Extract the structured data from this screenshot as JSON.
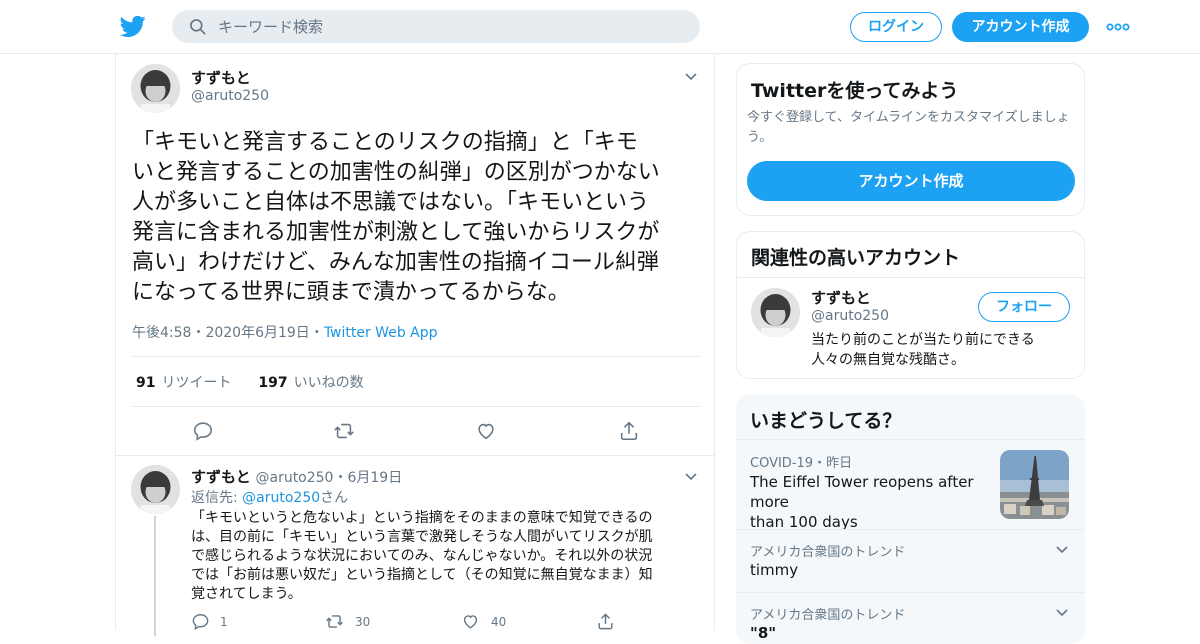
{
  "header": {
    "search_placeholder": "キーワード検索",
    "login_label": "ログイン",
    "signup_label": "アカウント作成"
  },
  "tweet": {
    "name": "すずもと",
    "handle": "@aruto250",
    "text_lines": [
      "「キモいと発言することのリスクの指摘」と「キモ",
      "いと発言することの加害性の糾弾」の区別がつかない",
      "人が多いこと自体は不思議ではない。「キモいという",
      "発言に含まれる加害性が刺激として強いからリスクが",
      "高い」わけだけど、みんな加害性の指摘イコール糾弾",
      "になってる世界に頭まで漬かってるからな。"
    ],
    "time": "午後4:58",
    "date": "2020年6月19日",
    "sep": "・",
    "source": "Twitter Web App",
    "retweets": "91",
    "retweets_label": "リツイート",
    "likes": "197",
    "likes_label": "いいねの数"
  },
  "reply": {
    "name": "すずもと",
    "handle": "@aruto250",
    "sep": "・",
    "date": "6月19日",
    "reply_to_prefix": "返信先: ",
    "reply_to_handle": "@aruto250",
    "reply_to_suffix": "さん",
    "text_lines": [
      "「キモいというと危ないよ」という指摘をそのままの意味で知覚できるの",
      "は、目の前に「キモい」という言葉で激発しそうな人間がいてリスクが肌",
      "で感じられるような状況においてのみ、なんじゃないか。それ以外の状況",
      "では「お前は悪い奴だ」という指摘として（その知覚に無自覚なまま）知",
      "覚されてしまう。"
    ],
    "reply_count": "1",
    "retweet_count": "30",
    "like_count": "40"
  },
  "signup_card": {
    "title": "Twitterを使ってみよう",
    "subtitle_lines": [
      "今すぐ登録して、タイムラインをカスタマイズしましょ",
      "う。"
    ],
    "button": "アカウント作成"
  },
  "related_card": {
    "title": "関連性の高いアカウント",
    "name": "すずもと",
    "handle": "@aruto250",
    "follow": "フォロー",
    "bio_lines": [
      "当たり前のことが当たり前にできる",
      "人々の無自覚な残酷さ。"
    ]
  },
  "trends_card": {
    "title": "いまどうしてる？",
    "items": [
      {
        "context": "COVID-19",
        "sep": "・",
        "time": "昨日",
        "title_lines": [
          "The Eiffel Tower reopens after more",
          "than 100 days"
        ]
      },
      {
        "context": "アメリカ合衆国のトレンド",
        "title": "timmy"
      },
      {
        "context": "アメリカ合衆国のトレンド",
        "title": "\"8\" "
      }
    ]
  },
  "colors": {
    "accent": "#1da1f2",
    "link": "#1b95e0",
    "text": "#14171a",
    "muted": "#657786",
    "border": "#e6ecf0"
  },
  "icons": [
    "twitter-bird-icon",
    "search-icon",
    "more-icon",
    "chevron-down-icon",
    "reply-icon",
    "retweet-icon",
    "like-icon",
    "share-icon"
  ]
}
